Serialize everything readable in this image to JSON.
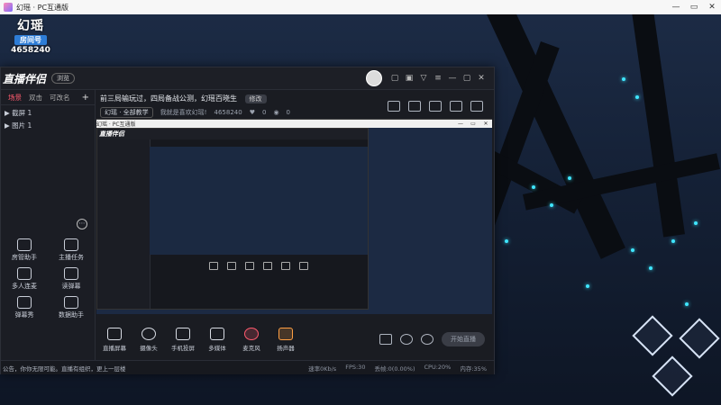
{
  "window": {
    "title": "幻瑶 · PC互通版",
    "controls": [
      "—",
      "▭",
      "✕"
    ]
  },
  "overlay": {
    "logo": "幻瑶",
    "room_label": "房间号",
    "room_number": "4658240"
  },
  "app": {
    "brand": "直播伴侣",
    "brand_badge": "浏览",
    "left_tabs": [
      "场景",
      "双击",
      "可改名"
    ],
    "add_label": "+",
    "scenes": [
      "▶ 截屏 1",
      "▶ 图片 1"
    ],
    "tools": [
      {
        "label": "房管助手"
      },
      {
        "label": "主播任务"
      },
      {
        "label": "多人连麦"
      },
      {
        "label": "读弹幕"
      },
      {
        "label": "弹幕秀"
      },
      {
        "label": "数据助手"
      }
    ],
    "stream_title": "前三局输玩过，四局备战公测，幻瑶百晓生",
    "edit_label": "修改",
    "category": "幻瑶 · 全部教学",
    "subtitle": "我就是喜欢幻瑶!",
    "room_number": "4658240",
    "likes": "0",
    "viewers": "0",
    "toolbar": [
      {
        "label": "直播屏幕",
        "icon": "monitor-icon"
      },
      {
        "label": "摄像头",
        "icon": "camera-icon"
      },
      {
        "label": "手机投屏",
        "icon": "phone-cast-icon"
      },
      {
        "label": "多媒体",
        "icon": "media-icon"
      },
      {
        "label": "麦克风",
        "icon": "mic-icon"
      },
      {
        "label": "扬声器",
        "icon": "speaker-icon"
      }
    ],
    "go_live": "开始直播",
    "status_message": "公告，你你无限可能。直播有组织，更上一层楼",
    "status_stats": [
      "速率0Kb/s",
      "FPS:30",
      "丢帧:0(0.00%)",
      "CPU:20%",
      "内存:35%"
    ]
  },
  "preview": {
    "bar_title": "幻瑶 · PC互通版",
    "nested_brand": "直播伴侣"
  },
  "colors": {
    "accent": "#ff5a6e",
    "brand_blue": "#2e7dd7",
    "glow": "#3fe6ff"
  }
}
